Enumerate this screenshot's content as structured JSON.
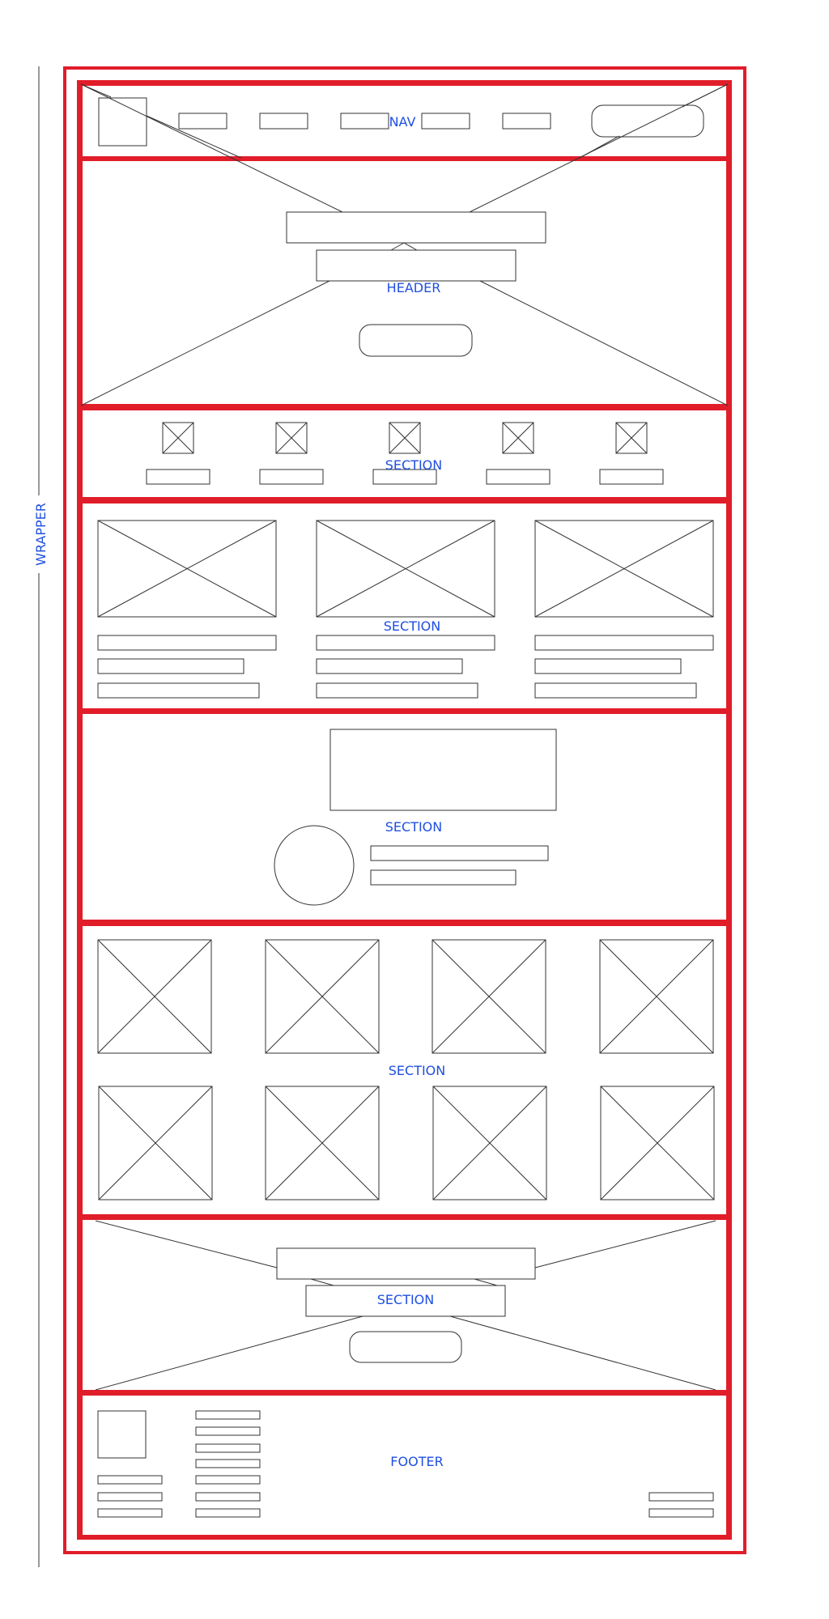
{
  "labels": {
    "wrapper": "WRAPPER",
    "nav": "NAV",
    "header": "HEADER",
    "section_icons": "SECTION",
    "section_cards": "SECTION",
    "section_profile": "SECTION",
    "section_gallery": "SECTION",
    "section_cta": "SECTION",
    "footer": "FOOTER"
  },
  "colors": {
    "outline": "#e11d2a",
    "label": "#1f4fe0",
    "wire": "#333333"
  }
}
